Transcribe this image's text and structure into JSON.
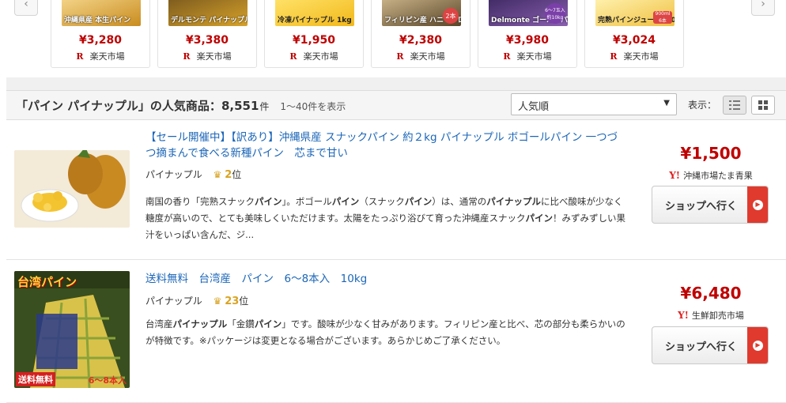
{
  "carousel": {
    "prev_icon": "chevron-left-icon",
    "next_icon": "chevron-right-icon",
    "items": [
      {
        "thumb_text": "沖縄県産 本生パイン",
        "thumb_color": "#c98c1f",
        "price": "¥3,280",
        "shop": "楽天市場"
      },
      {
        "thumb_text": "デルモンテ パイナップル大玉",
        "thumb_color": "#d7a22a",
        "price": "¥3,380",
        "shop": "楽天市場"
      },
      {
        "thumb_text": "冷凍パイナップル 1kg",
        "thumb_color": "#f2c21a",
        "price": "¥1,950",
        "shop": "楽天市場"
      },
      {
        "thumb_text": "フィリピン産 ハニーグロウ",
        "thumb_color": "#8a6b3a",
        "price": "¥2,380",
        "shop": "楽天市場"
      },
      {
        "thumb_text": "Delmonte ゴールドパイン",
        "thumb_color": "#6a3f8c",
        "price": "¥3,980",
        "shop": "楽天市場"
      },
      {
        "thumb_text": "完熟パインジュース100",
        "thumb_color": "#f0c040",
        "price": "¥3,024",
        "shop": "楽天市場"
      }
    ],
    "badges": [
      "2本",
      "6〜7玉入 約10kg",
      "900ml 6本"
    ]
  },
  "results": {
    "title": "「パイン パイナップル」の人気商品：",
    "count": "8,551",
    "count_unit": "件",
    "range": "1〜40件を表示",
    "sort": {
      "selected": "人気順"
    },
    "view_label": "表示：",
    "list_view_icon": "list-view-icon",
    "grid_view_icon": "grid-view-icon"
  },
  "products": [
    {
      "title": "【セール開催中】【訳あり】沖縄県産 スナックパイン 約２kg パイナップル ボゴールパイン 一つづつ摘まんで食べる新種パイン　芯まで甘い",
      "category": "パイナップル",
      "rank": "2",
      "rank_suffix": "位",
      "desc": [
        "南国の香り「完熟スナック",
        "パイン",
        "」。ボゴール",
        "パイン",
        "（スナック",
        "パイン",
        "）は、通常の",
        "パイナップル",
        "に比べ酸味が少なく糖度が高いので、とても美味しくいただけます。太陽をたっぷり浴びて育った沖縄産スナック",
        "パイン",
        "！みずみずしい果汁をいっぱい含んだ、ジ..."
      ],
      "price": "¥1,500",
      "shop": "沖縄市場たま青果",
      "button": "ショップへ行く"
    },
    {
      "title": "送料無料　台湾産　パイン　6〜8本入　10kg",
      "category": "パイナップル",
      "rank": "23",
      "rank_suffix": "位",
      "desc": [
        "台湾産",
        "パイナップル",
        "「金鑽",
        "パイン",
        "」です。酸味が少なく甘みがあります。フィリピン産と比べ、芯の部分も柔らかいのが特徴です。※パッケージは変更となる場合がございます。あらかじめご了承ください。"
      ],
      "price": "¥6,480",
      "shop": "生鮮卸売市場",
      "button": "ショップへ行く",
      "image_label_top": "台湾パイン",
      "image_label_bottom_left": "送料無料",
      "image_label_bottom_right": "6〜8本入"
    }
  ],
  "shop_marks": {
    "rakuten": "R",
    "yahoo": "Y!"
  }
}
